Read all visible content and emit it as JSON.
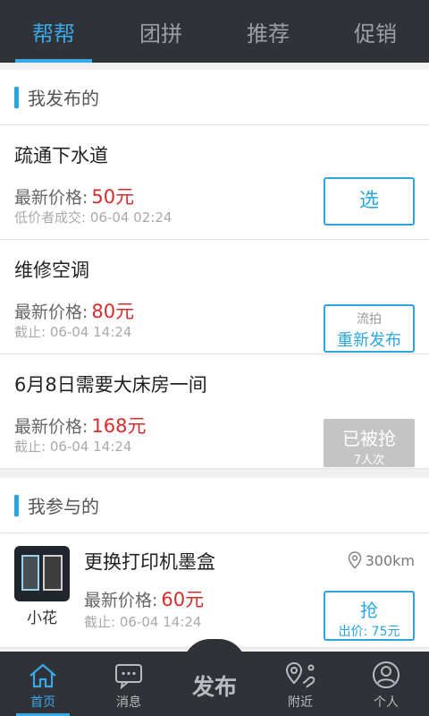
{
  "top_tabs": [
    "帮帮",
    "团拼",
    "推荐",
    "促销"
  ],
  "published": {
    "section_title": "我发布的",
    "items": [
      {
        "name": "疏通下水道",
        "price_label": "最新价格:",
        "price": "50元",
        "meta": "低价者成交: 06-04  02:24",
        "button": "选"
      },
      {
        "name": "维修空调",
        "price_label": "最新价格:",
        "price": "80元",
        "meta": "截止: 06-04   14:24",
        "button_small": "流拍",
        "button": "重新发布"
      },
      {
        "name": "6月8日需要大床房一间",
        "price_label": "最新价格:",
        "price": "168元",
        "meta": "截止: 06-04   14:24",
        "button": "已被抢",
        "button_small": "7人次"
      }
    ]
  },
  "participated": {
    "section_title": "我参与的",
    "items": [
      {
        "user": "小花",
        "name": "更换打印机墨盒",
        "distance": "300km",
        "price_label": "最新价格:",
        "price": "60元",
        "meta": "截止: 06-04   14:24",
        "button": "抢",
        "button_small": "出价: 75元"
      }
    ]
  },
  "bottom_nav": {
    "home": "首页",
    "messages": "消息",
    "publish": "发布",
    "nearby": "附近",
    "profile": "个人"
  },
  "colors": {
    "accent": "#3aa9e8",
    "price": "#d92b2b",
    "bar": "#2f3337"
  }
}
